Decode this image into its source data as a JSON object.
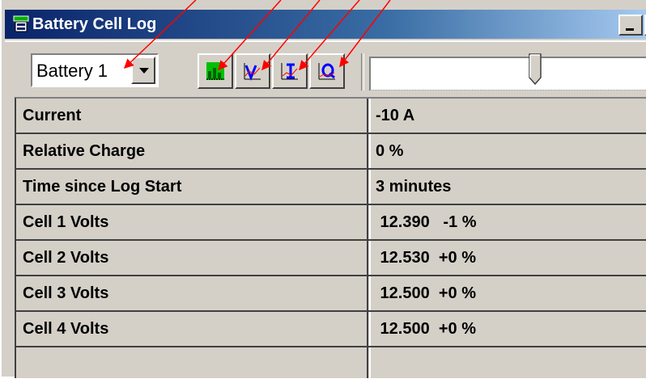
{
  "window": {
    "title": "Battery Cell Log",
    "icon": "battery-log-app-icon",
    "controls": [
      "minimize-button",
      "maximize-button"
    ]
  },
  "toolbar": {
    "battery_select": {
      "value": "Battery 1"
    },
    "buttons": [
      {
        "icon": "charge-bar-chart-icon"
      },
      {
        "icon": "voltage-chart-icon"
      },
      {
        "icon": "current-chart-icon"
      },
      {
        "icon": "charge-q-chart-icon"
      }
    ],
    "slider": {
      "level": 0.59
    }
  },
  "table": {
    "rows": [
      {
        "label": "Current",
        "value": "-10 A"
      },
      {
        "label": "Relative Charge",
        "value": "0 %"
      },
      {
        "label": "Time since Log Start",
        "value": "3 minutes"
      },
      {
        "label": "Cell 1 Volts",
        "value": " 12.390   -1 %"
      },
      {
        "label": "Cell 2 Volts",
        "value": " 12.530  +0 %"
      },
      {
        "label": "Cell 3 Volts",
        "value": " 12.500  +0 %"
      },
      {
        "label": "Cell 4 Volts",
        "value": " 12.500  +0 %"
      },
      {
        "label": "",
        "value": ""
      }
    ]
  },
  "annotations": {
    "arrow_color": "#ff0000",
    "arrow_count": 5
  },
  "colors": {
    "titlebar_start": "#0a246a",
    "titlebar_end": "#a6caf0",
    "face": "#d4d0c8"
  }
}
